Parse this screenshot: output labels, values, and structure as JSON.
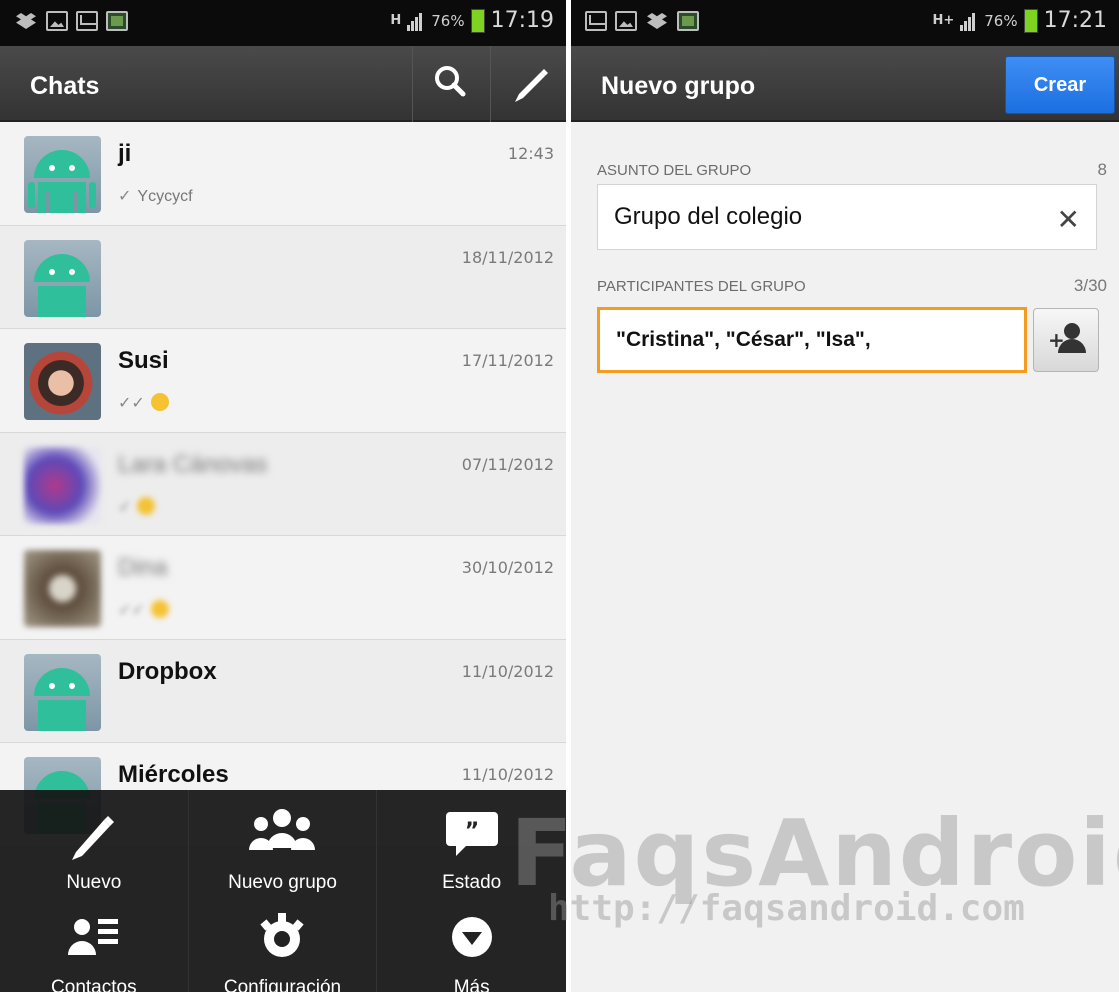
{
  "left_screen": {
    "status": {
      "network": "H",
      "battery": "76%",
      "time": "17:19"
    },
    "actionbar": {
      "title": "Chats"
    },
    "chats": [
      {
        "name": "ji",
        "time": "12:43",
        "preview": "Ycycycf",
        "avatar": "android-default"
      },
      {
        "name": "",
        "time": "18/11/2012",
        "preview": "",
        "avatar": "android-default"
      },
      {
        "name": "Susi",
        "time": "17/11/2012",
        "preview": "",
        "avatar": "photo"
      },
      {
        "name": "Lara Cánovas",
        "time": "07/11/2012",
        "preview": "",
        "avatar": "blurred"
      },
      {
        "name": "Dina",
        "time": "30/10/2012",
        "preview": "",
        "avatar": "blurred"
      },
      {
        "name": "Dropbox",
        "time": "11/10/2012",
        "preview": "",
        "avatar": "android-default"
      },
      {
        "name": "Miércoles",
        "time": "11/10/2012",
        "preview": "",
        "avatar": "android-default"
      }
    ],
    "menu": {
      "items": [
        {
          "label": "Nuevo",
          "icon": "pencil-icon"
        },
        {
          "label": "Nuevo grupo",
          "icon": "group-icon"
        },
        {
          "label": "Estado",
          "icon": "quote-bubble-icon"
        },
        {
          "label": "Contactos",
          "icon": "contacts-icon"
        },
        {
          "label": "Configuración",
          "icon": "gear-icon"
        },
        {
          "label": "Más",
          "icon": "chevron-down-circle-icon"
        }
      ]
    }
  },
  "right_screen": {
    "status": {
      "network": "H+",
      "battery": "76%",
      "time": "17:21"
    },
    "actionbar": {
      "title": "Nuevo grupo",
      "create_label": "Crear"
    },
    "subject": {
      "label": "ASUNTO DEL GRUPO",
      "count": "8",
      "value": "Grupo del colegio"
    },
    "participants": {
      "label": "PARTICIPANTES DEL GRUPO",
      "count": "3/30",
      "value": "\"Cristina\", \"César\", \"Isa\","
    }
  },
  "watermark": {
    "brand": "FaqsAndroid",
    "url": "http://faqsandroid.com"
  },
  "colors": {
    "accent_blue": "#1c6fe0",
    "focus_orange": "#f39c20",
    "android_green": "#2fbf9b",
    "battery_green": "#7ed321"
  }
}
